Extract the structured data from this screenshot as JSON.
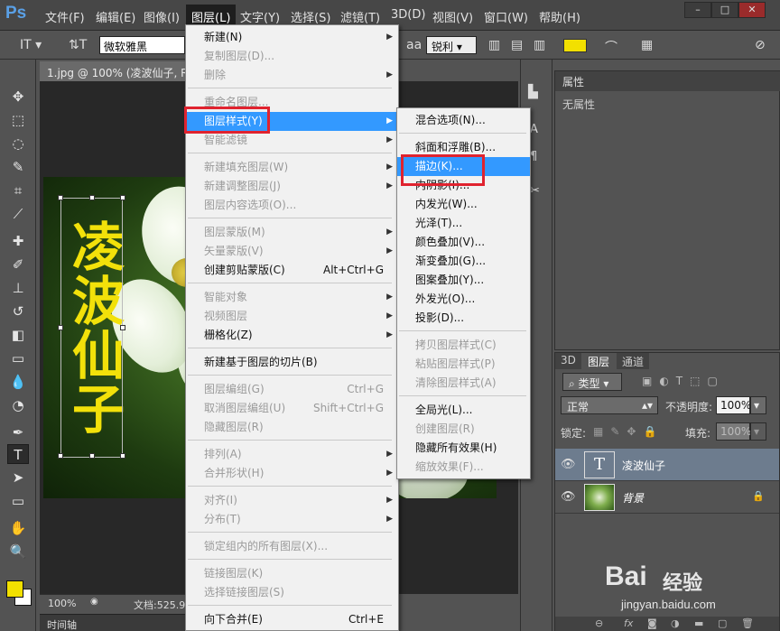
{
  "app": {
    "logo": "Ps",
    "menus": [
      "文件(F)",
      "编辑(E)",
      "图像(I)",
      "图层(L)",
      "文字(Y)",
      "选择(S)",
      "滤镜(T)",
      "3D(D)",
      "视图(V)",
      "窗口(W)",
      "帮助(H)"
    ],
    "active_menu": "图层(L)"
  },
  "options_bar": {
    "font": "微软雅黑",
    "antialias_label": "aa",
    "antialias": "锐利",
    "text_color": "#f2e000"
  },
  "document": {
    "tab_title": "1.jpg @ 100% (凌波仙子, RG",
    "text_content": "凌波仙子",
    "zoom": "100%",
    "doc_info": "文档:525.9"
  },
  "timeline_label": "时间轴",
  "layer_menu": [
    {
      "label": "新建(N)",
      "shortcut": "",
      "submenu": true,
      "disabled": false
    },
    {
      "label": "复制图层(D)...",
      "shortcut": "",
      "submenu": false,
      "disabled": true
    },
    {
      "label": "删除",
      "shortcut": "",
      "submenu": true,
      "disabled": true
    },
    {
      "sep": true
    },
    {
      "label": "重命名图层...",
      "shortcut": "",
      "submenu": false,
      "disabled": true
    },
    {
      "label": "图层样式(Y)",
      "shortcut": "",
      "submenu": true,
      "disabled": false,
      "highlight": true
    },
    {
      "label": "智能滤镜",
      "shortcut": "",
      "submenu": true,
      "disabled": true
    },
    {
      "sep": true
    },
    {
      "label": "新建填充图层(W)",
      "shortcut": "",
      "submenu": true,
      "disabled": true
    },
    {
      "label": "新建调整图层(J)",
      "shortcut": "",
      "submenu": true,
      "disabled": true
    },
    {
      "label": "图层内容选项(O)...",
      "shortcut": "",
      "submenu": false,
      "disabled": true
    },
    {
      "sep": true
    },
    {
      "label": "图层蒙版(M)",
      "shortcut": "",
      "submenu": true,
      "disabled": true
    },
    {
      "label": "矢量蒙版(V)",
      "shortcut": "",
      "submenu": true,
      "disabled": true
    },
    {
      "label": "创建剪贴蒙版(C)",
      "shortcut": "Alt+Ctrl+G",
      "submenu": false,
      "disabled": false
    },
    {
      "sep": true
    },
    {
      "label": "智能对象",
      "shortcut": "",
      "submenu": true,
      "disabled": true
    },
    {
      "label": "视频图层",
      "shortcut": "",
      "submenu": true,
      "disabled": true
    },
    {
      "label": "栅格化(Z)",
      "shortcut": "",
      "submenu": true,
      "disabled": false
    },
    {
      "sep": true
    },
    {
      "label": "新建基于图层的切片(B)",
      "shortcut": "",
      "submenu": false,
      "disabled": false
    },
    {
      "sep": true
    },
    {
      "label": "图层编组(G)",
      "shortcut": "Ctrl+G",
      "submenu": false,
      "disabled": true
    },
    {
      "label": "取消图层编组(U)",
      "shortcut": "Shift+Ctrl+G",
      "submenu": false,
      "disabled": true
    },
    {
      "label": "隐藏图层(R)",
      "shortcut": "",
      "submenu": false,
      "disabled": true
    },
    {
      "sep": true
    },
    {
      "label": "排列(A)",
      "shortcut": "",
      "submenu": true,
      "disabled": true
    },
    {
      "label": "合并形状(H)",
      "shortcut": "",
      "submenu": true,
      "disabled": true
    },
    {
      "sep": true
    },
    {
      "label": "对齐(I)",
      "shortcut": "",
      "submenu": true,
      "disabled": true
    },
    {
      "label": "分布(T)",
      "shortcut": "",
      "submenu": true,
      "disabled": true
    },
    {
      "sep": true
    },
    {
      "label": "锁定组内的所有图层(X)...",
      "shortcut": "",
      "submenu": false,
      "disabled": true
    },
    {
      "sep": true
    },
    {
      "label": "链接图层(K)",
      "shortcut": "",
      "submenu": false,
      "disabled": true
    },
    {
      "label": "选择链接图层(S)",
      "shortcut": "",
      "submenu": false,
      "disabled": true
    },
    {
      "sep": true
    },
    {
      "label": "向下合并(E)",
      "shortcut": "Ctrl+E",
      "submenu": false,
      "disabled": false
    }
  ],
  "style_submenu": [
    {
      "label": "混合选项(N)...",
      "disabled": false
    },
    {
      "sep": true
    },
    {
      "label": "斜面和浮雕(B)...",
      "disabled": false
    },
    {
      "label": "描边(K)...",
      "disabled": false,
      "highlight": true
    },
    {
      "label": "内阴影(I)...",
      "disabled": false
    },
    {
      "label": "内发光(W)...",
      "disabled": false
    },
    {
      "label": "光泽(T)...",
      "disabled": false
    },
    {
      "label": "颜色叠加(V)...",
      "disabled": false
    },
    {
      "label": "渐变叠加(G)...",
      "disabled": false
    },
    {
      "label": "图案叠加(Y)...",
      "disabled": false
    },
    {
      "label": "外发光(O)...",
      "disabled": false
    },
    {
      "label": "投影(D)...",
      "disabled": false
    },
    {
      "sep": true
    },
    {
      "label": "拷贝图层样式(C)",
      "disabled": true
    },
    {
      "label": "粘贴图层样式(P)",
      "disabled": true
    },
    {
      "label": "清除图层样式(A)",
      "disabled": true
    },
    {
      "sep": true
    },
    {
      "label": "全局光(L)...",
      "disabled": false
    },
    {
      "label": "创建图层(R)",
      "disabled": true
    },
    {
      "label": "隐藏所有效果(H)",
      "disabled": false
    },
    {
      "label": "缩放效果(F)...",
      "disabled": true
    }
  ],
  "properties": {
    "tab": "属性",
    "body": "无属性"
  },
  "layers_panel": {
    "tabs": [
      "3D",
      "图层",
      "通道"
    ],
    "active_tab": "图层",
    "filter": "类型",
    "blend_mode": "正常",
    "opacity_label": "不透明度:",
    "opacity": "100%",
    "lock_label": "锁定:",
    "fill_label": "填充:",
    "fill": "100%",
    "layers": [
      {
        "name": "凌波仙子",
        "type": "text",
        "thumb": "T",
        "selected": true
      },
      {
        "name": "背景",
        "type": "image",
        "selected": false,
        "locked": true
      }
    ]
  },
  "watermark": {
    "brand": "Bai",
    "brand_suffix": "经验",
    "url": "jingyan.baidu.com"
  }
}
